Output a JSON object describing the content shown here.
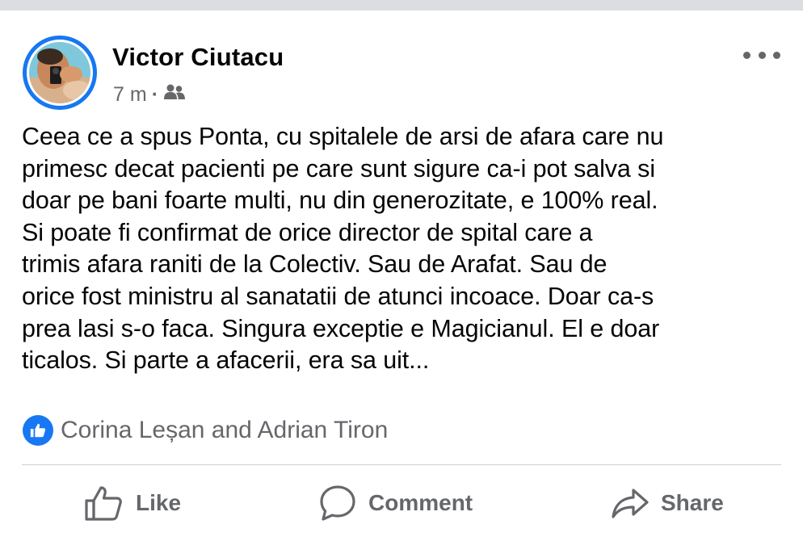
{
  "post": {
    "author": "Victor Ciutacu",
    "time": "7 m",
    "separator": "·",
    "audience_icon": "friends-icon",
    "text": "Ceea ce a spus Ponta, cu spitalele de arsi de afara care nu\nprimesc decat pacienti pe care sunt sigure ca-i pot salva si\ndoar pe bani foarte multi, nu din generozitate, e 100% real.\nSi poate fi confirmat de orice director de spital care a\ntrimis afara raniti de la Colectiv. Sau de Arafat. Sau de\norice fost ministru al sanatatii de atunci incoace. Doar ca-s\nprea lasi s-o faca. Singura exceptie e Magicianul. El e doar\nticalos. Si parte a afacerii, era sa uit...",
    "reactions": {
      "icon": "like-reaction-icon",
      "names": "Corina Leșan and Adrian Tiron"
    }
  },
  "actions": {
    "like": "Like",
    "comment": "Comment",
    "share": "Share"
  },
  "colors": {
    "accent": "#1877f2",
    "secondary_text": "#65676b",
    "divider": "#ced0d4",
    "top_bar": "#dcdde1"
  }
}
